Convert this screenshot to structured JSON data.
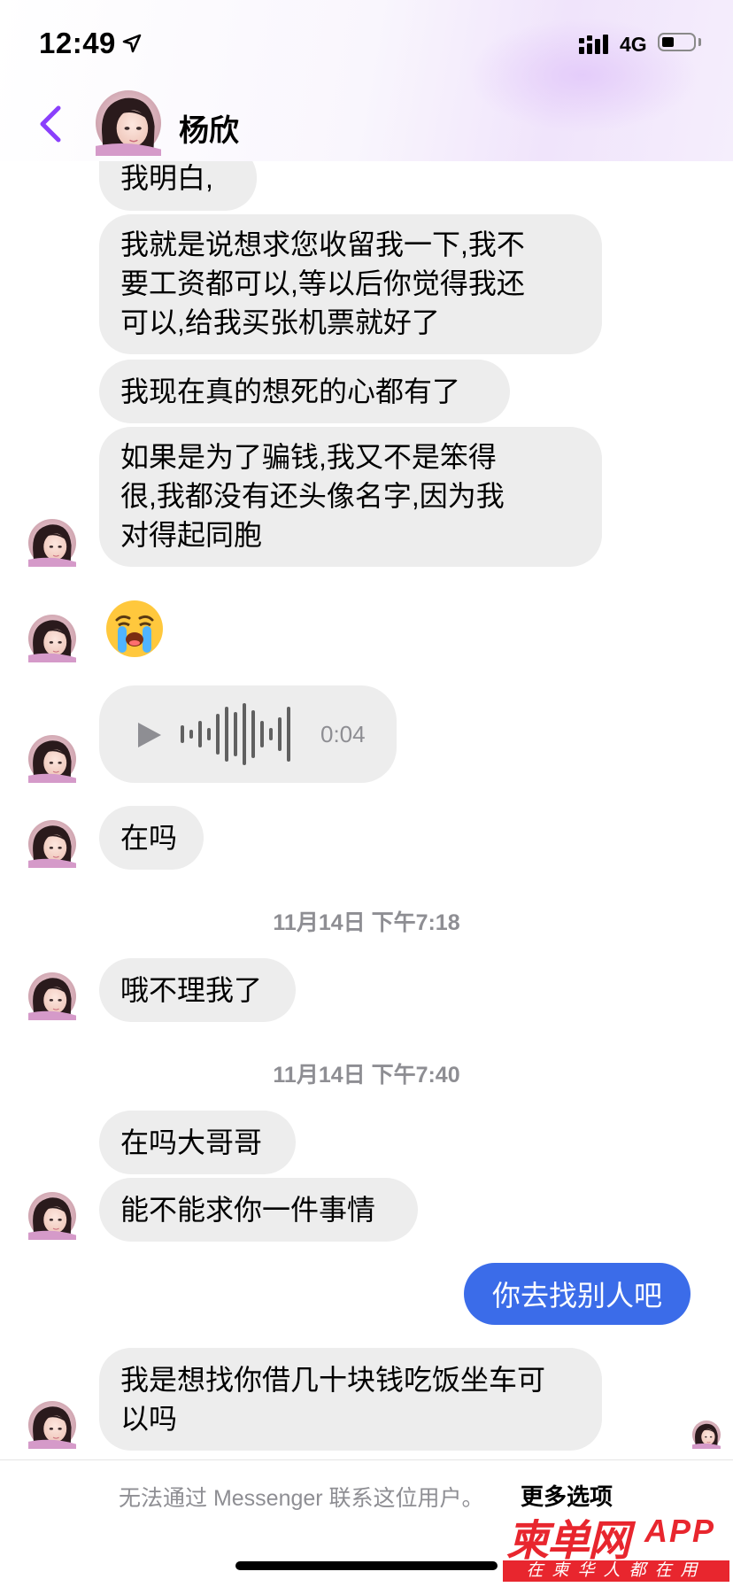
{
  "status_bar": {
    "time": "12:49",
    "network": "4G"
  },
  "header": {
    "contact_name": "杨欣",
    "back_icon": "chevron-left-icon",
    "accent_color": "#8a3ffc"
  },
  "messages": {
    "m1": "我明白,",
    "m2": [
      "我就是说想求您收留我一下,我不",
      "要工资都可以,等以后你觉得我还",
      "可以,给我买张机票就好了"
    ],
    "m3": "我现在真的想死的心都有了",
    "m4": [
      "如果是为了骗钱,我又不是笨得",
      "很,我都没有还头像名字,因为我",
      "对得起同胞"
    ],
    "emoji": "loudly-crying-face-emoji",
    "voice": {
      "duration": "0:04",
      "play_icon": "play-icon"
    },
    "m5": "在吗",
    "ts1": "11月14日 下午7:18",
    "m6": "哦不理我了",
    "ts2": "11月14日 下午7:40",
    "m7": "在吗大哥哥",
    "m8": "能不能求你一件事情",
    "sent1": "你去找别人吧",
    "m9": [
      "我是想找你借几十块钱吃饭坐车可",
      "以吗"
    ]
  },
  "colors": {
    "received_bubble": "#ededed",
    "sent_bubble": "#3b6ce9",
    "timestamp": "#8e8e93"
  },
  "footer": {
    "notice": "无法通过 Messenger 联系这位用户。",
    "more_options": "更多选项"
  },
  "watermark": {
    "brand": "柬单网",
    "app": "APP",
    "tagline": "在柬华人都在用",
    "color": "#e8262e"
  }
}
